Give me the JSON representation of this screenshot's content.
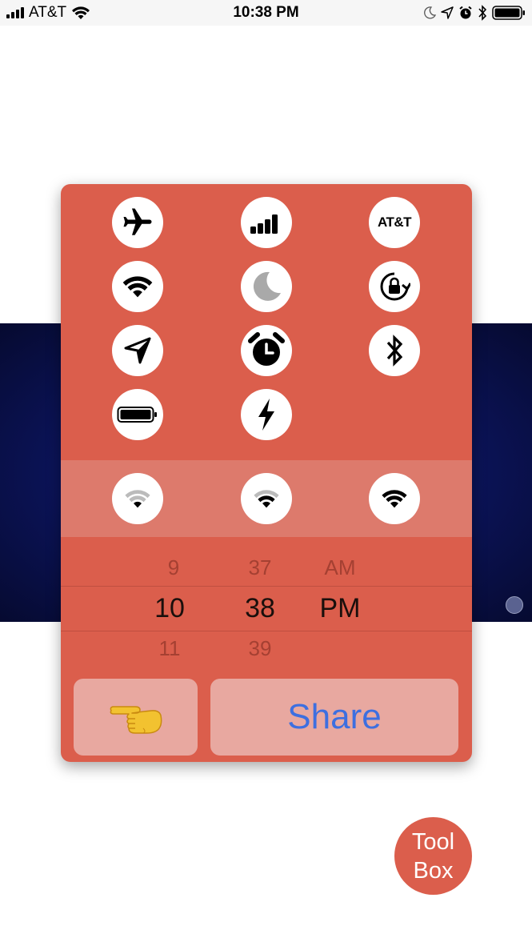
{
  "status_bar": {
    "carrier": "AT&T",
    "time": "10:38 PM",
    "icons": [
      "signal-bars-icon",
      "wifi-icon",
      "moon-icon",
      "location-arrow-icon",
      "alarm-icon",
      "bluetooth-icon",
      "battery-icon"
    ]
  },
  "panel": {
    "color": "#db5e4c",
    "icon_grid": [
      {
        "name": "airplane-icon"
      },
      {
        "name": "signal-bars-icon"
      },
      {
        "name": "carrier-icon",
        "label": "AT&T"
      },
      {
        "name": "wifi-icon"
      },
      {
        "name": "moon-icon"
      },
      {
        "name": "rotation-lock-icon"
      },
      {
        "name": "location-arrow-icon"
      },
      {
        "name": "alarm-clock-icon"
      },
      {
        "name": "bluetooth-icon"
      },
      {
        "name": "battery-icon"
      },
      {
        "name": "lightning-icon"
      }
    ],
    "wifi_strengths": [
      "wifi-weak-icon",
      "wifi-medium-icon",
      "wifi-full-icon"
    ],
    "time_picker": {
      "hour": {
        "prev": "9",
        "current": "10",
        "next": "11"
      },
      "minute": {
        "prev": "37",
        "current": "38",
        "next": "39"
      },
      "period": {
        "prev": "AM",
        "current": "PM"
      }
    },
    "pointing_button": {
      "emoji": "👈"
    },
    "share_button": {
      "label": "Share",
      "color": "#3d6fe0"
    }
  },
  "toolbox_button": {
    "line1": "Tool",
    "line2": "Box"
  }
}
